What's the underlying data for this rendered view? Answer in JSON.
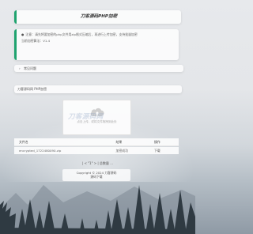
{
  "header": {
    "title": "刀客源码PHP加密"
  },
  "notice": {
    "line1": "注意：请先将要加密的php文件用zip格式压缩后，再进行上传加密，支持批量加密",
    "line2": "当前加密算法：V1.4"
  },
  "faq": {
    "label": "常见问题"
  },
  "tab": {
    "label": "刀客源码网 PHP加密"
  },
  "upload": {
    "watermark": "刀客源码网",
    "hint": "点击上传，或将文件拖拽到此处"
  },
  "table": {
    "headers": [
      "文件名",
      "结果",
      "操作"
    ],
    "rows": [
      {
        "name": "encrypted_1722480090.zip",
        "status": "加密成功",
        "action": "下载"
      }
    ]
  },
  "pager": {
    "text": "| < \"1\" > | 总数量 ..."
  },
  "footer": {
    "copyright": "Copyright © 2024 刀客源码",
    "link": "源码下载"
  },
  "colors": {
    "accent": "#1fa36f"
  },
  "icons": {
    "upload": "cloud-upload-icon",
    "faq": "chevron-right-icon"
  }
}
